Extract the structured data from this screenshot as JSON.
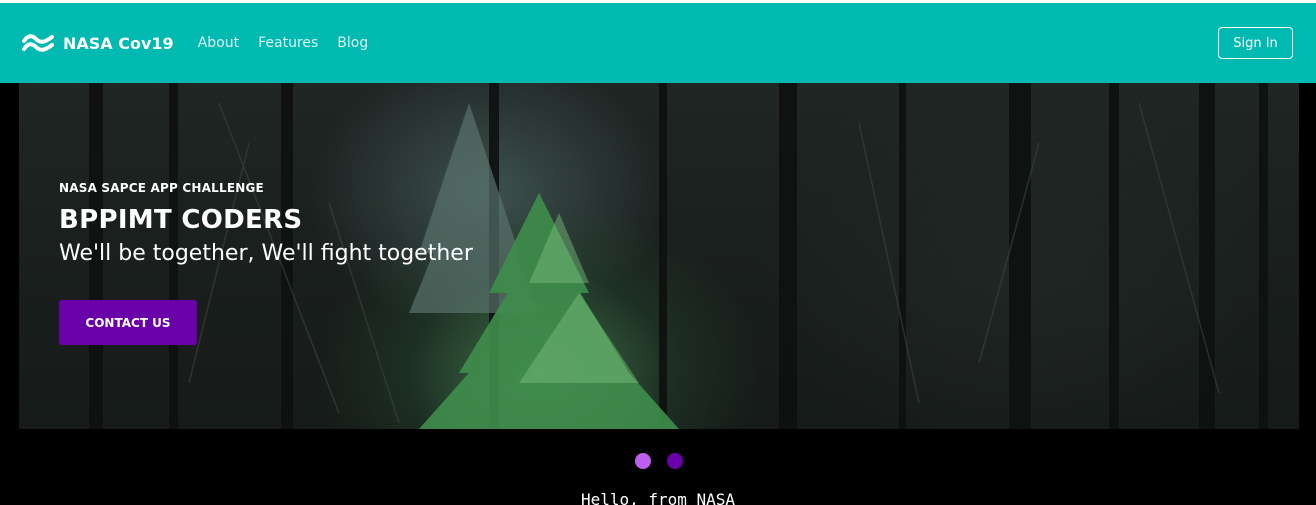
{
  "nav": {
    "brand": "NASA Cov19",
    "links": [
      "About",
      "Features",
      "Blog"
    ],
    "signin_label": "Sign In"
  },
  "hero": {
    "kicker": "NASA SAPCE APP CHALLENGE",
    "title": "BPPIMT CODERS",
    "subtitle": "We'll be together, We'll fight together",
    "cta_label": "CONTACT US"
  },
  "carousel": {
    "dot_colors": [
      "#bf5ff0",
      "#6a00a8"
    ]
  },
  "footer": {
    "hello": "Hello, from NASA"
  },
  "colors": {
    "navbar": "#00b9b0",
    "cta": "#6a00a8",
    "background": "#000000"
  }
}
